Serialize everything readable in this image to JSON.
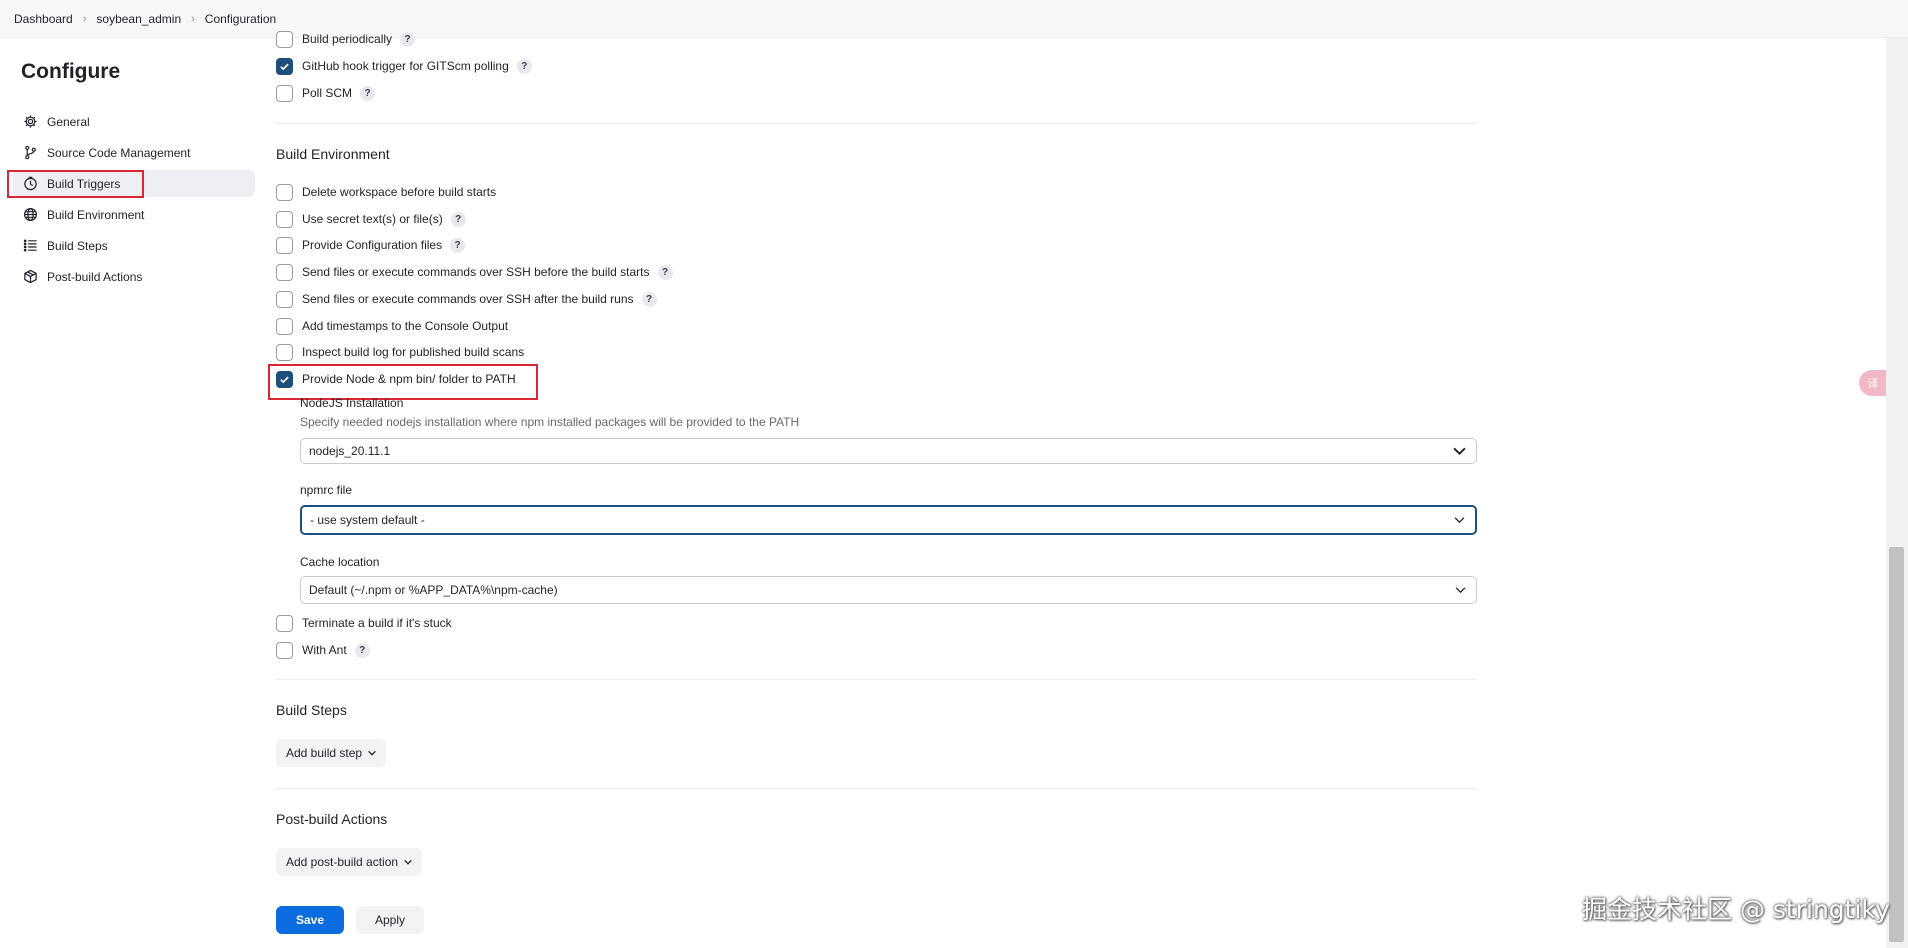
{
  "breadcrumb": {
    "items": [
      "Dashboard",
      "soybean_admin",
      "Configuration"
    ],
    "separator": "›"
  },
  "sidebar": {
    "title": "Configure",
    "items": [
      {
        "label": "General",
        "icon": "gear-icon"
      },
      {
        "label": "Source Code Management",
        "icon": "branch-icon"
      },
      {
        "label": "Build Triggers",
        "icon": "clock-icon",
        "active": true
      },
      {
        "label": "Build Environment",
        "icon": "globe-icon"
      },
      {
        "label": "Build Steps",
        "icon": "list-icon"
      },
      {
        "label": "Post-build Actions",
        "icon": "package-icon"
      }
    ]
  },
  "triggers": {
    "items": [
      {
        "label": "Build periodically",
        "checked": false,
        "help": "?"
      },
      {
        "label": "GitHub hook trigger for GITScm polling",
        "checked": true,
        "help": "?"
      },
      {
        "label": "Poll SCM",
        "checked": false,
        "help": "?"
      }
    ]
  },
  "build_environment": {
    "title": "Build Environment",
    "options": [
      {
        "label": "Delete workspace before build starts",
        "checked": false
      },
      {
        "label": "Use secret text(s) or file(s)",
        "checked": false,
        "help": "?"
      },
      {
        "label": "Provide Configuration files",
        "checked": false,
        "help": "?"
      },
      {
        "label": "Send files or execute commands over SSH before the build starts",
        "checked": false,
        "help": "?"
      },
      {
        "label": "Send files or execute commands over SSH after the build runs",
        "checked": false,
        "help": "?"
      },
      {
        "label": "Add timestamps to the Console Output",
        "checked": false
      },
      {
        "label": "Inspect build log for published build scans",
        "checked": false
      },
      {
        "label": "Provide Node & npm bin/ folder to PATH",
        "checked": true
      }
    ],
    "node": {
      "installation_label": "NodeJS Installation",
      "installation_desc": "Specify needed nodejs installation where npm installed packages will be provided to the PATH",
      "installation_value": "nodejs_20.11.1",
      "npmrc_label": "npmrc file",
      "npmrc_value": "- use system default -",
      "cache_label": "Cache location",
      "cache_value": "Default (~/.npm or %APP_DATA%\\npm-cache)"
    },
    "options_after": [
      {
        "label": "Terminate a build if it's stuck",
        "checked": false
      },
      {
        "label": "With Ant",
        "checked": false,
        "help": "?"
      }
    ]
  },
  "build_steps": {
    "title": "Build Steps",
    "add_label": "Add build step"
  },
  "post_build": {
    "title": "Post-build Actions",
    "add_label": "Add post-build action"
  },
  "footer": {
    "save_label": "Save",
    "apply_label": "Apply"
  },
  "floating_tab": {
    "label": "译"
  },
  "watermark": {
    "text": "掘金技术社区 @ stringtiky"
  },
  "colors": {
    "accent": "#1c4f7c",
    "primary_button": "#0a6cde",
    "highlight_box": "#d92634"
  }
}
